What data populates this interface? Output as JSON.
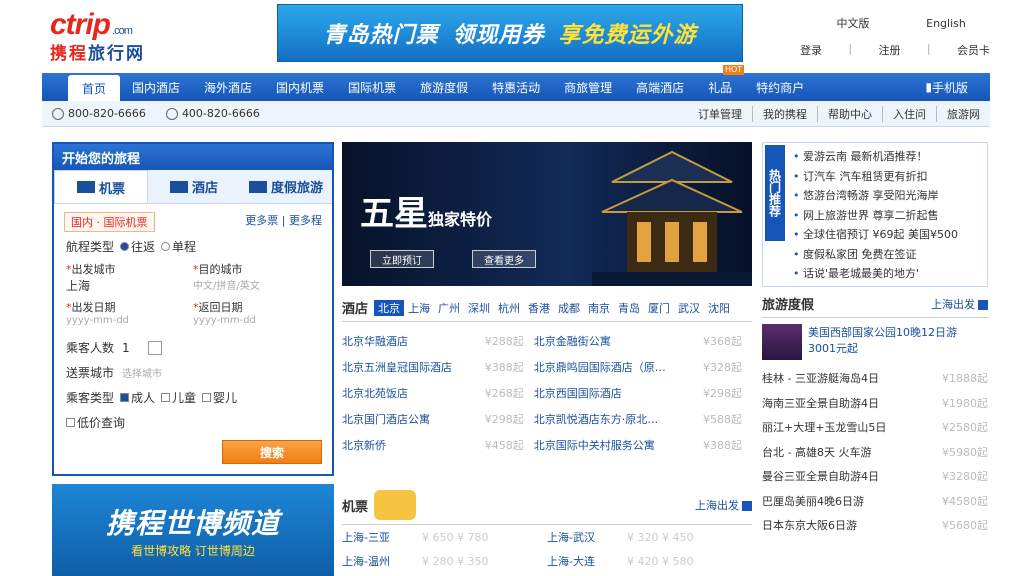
{
  "logo": {
    "brand": "ctrip",
    "domain": ".com",
    "cn_1": "携程",
    "cn_2": "旅行网"
  },
  "banner": {
    "part1": "青岛热门票",
    "part2": "领现用券",
    "part3": "享免费运外游"
  },
  "top": {
    "lang_cn": "中文版",
    "lang_en": "English",
    "login": "登录",
    "register": "注册",
    "card": "会员卡",
    "sep": "|"
  },
  "nav": {
    "items": [
      "首页",
      "国内酒店",
      "海外酒店",
      "国内机票",
      "国际机票",
      "旅游度假",
      "特惠活动",
      "商旅管理",
      "高端酒店",
      "礼品",
      "特约商户"
    ],
    "hot_badge": "HOT",
    "mobile": "手机版"
  },
  "subbar": {
    "phone1": "800-820-6666",
    "phone2": "400-820-6666",
    "links": [
      "订单管理",
      "我的携程",
      "帮助中心",
      "入住问",
      "旅游网"
    ]
  },
  "booking": {
    "header": "开始您的旅程",
    "tabs": [
      "机票",
      "酒店",
      "度假旅游"
    ],
    "flight_tab": "国内 · 国际机票",
    "flight_links": "更多票 | 更多程",
    "trip_type_label": "航程类型",
    "trip_options": [
      "往返",
      "单程"
    ],
    "from_label": "出发城市",
    "from_value": "上海",
    "to_label": "目的城市",
    "to_placeholder": "中文/拼音/英文",
    "depart_label": "出发日期",
    "depart_placeholder": "yyyy-mm-dd",
    "return_label": "返回日期",
    "return_placeholder": "yyyy-mm-dd",
    "passengers_label": "乘客人数",
    "passengers_value": "1",
    "delivery_label": "送票城市",
    "delivery_placeholder": "选择城市",
    "ptype_label": "乘客类型",
    "ptype_options": [
      "成人",
      "儿童",
      "婴儿"
    ],
    "query_link": "低价查询",
    "search_button": "搜索"
  },
  "expo": {
    "title": "携程世博频道",
    "subtitle": "看世博攻略 订世博周边"
  },
  "hero": {
    "title": "五星",
    "subtitle": "独家特价",
    "btn1": "立即预订",
    "btn2": "查看更多"
  },
  "hotels": {
    "title": "酒店",
    "cities": [
      "北京",
      "上海",
      "广州",
      "深圳",
      "杭州",
      "香港",
      "成都",
      "南京",
      "青岛",
      "厦门",
      "武汉",
      "沈阳"
    ],
    "rows": [
      [
        "北京华融酒店",
        "¥288起",
        "北京金融街公寓",
        "¥368起"
      ],
      [
        "北京五洲皇冠国际酒店",
        "¥388起",
        "北京鼎鸣园国际酒店（原…",
        "¥328起"
      ],
      [
        "北京北苑饭店",
        "¥268起",
        "北京西国国际酒店",
        "¥298起"
      ],
      [
        "北京国门酒店公寓",
        "¥298起",
        "北京凯悦酒店东方·原北…",
        "¥588起"
      ],
      [
        "北京新侨",
        "¥458起",
        "北京国际中关村服务公寓",
        "¥388起"
      ]
    ]
  },
  "flights": {
    "title": "机票",
    "departure": "上海出发",
    "rows": [
      [
        "上海-三亚",
        "¥ 650 ¥ 780",
        "上海-武汉",
        "¥ 320 ¥ 450"
      ],
      [
        "上海-温州",
        "¥ 280 ¥ 350",
        "上海-大连",
        "¥ 420 ¥ 580"
      ]
    ]
  },
  "hot_news": {
    "tag": "热门推荐",
    "items": [
      "爱游云南 最新机酒推荐！",
      "订汽车 汽车租赁更有折扣",
      "悠游台湾畅游 享受阳光海岸",
      "网上旅游世界 尊享二折起售",
      "全球住宿预订 ¥69起 美国¥500",
      "度假私家团 免费在签证",
      "话说'最老城最美的地方'"
    ]
  },
  "vacation": {
    "title": "旅游度假",
    "departure": "上海出发",
    "featured": "美国西部国家公园10晚12日游3001元起",
    "rows": [
      [
        "桂林 - 三亚游艇海岛4日",
        "¥1888起"
      ],
      [
        "海南三亚全景自助游4日",
        "¥1980起"
      ],
      [
        "丽江+大理+玉龙雪山5日",
        "¥2580起"
      ],
      [
        "台北 - 高雄8天 火车游",
        "¥5980起"
      ],
      [
        "曼谷三亚全景自助游4日",
        "¥3280起"
      ],
      [
        "巴厘岛美丽4晚6日游",
        "¥4580起"
      ],
      [
        "日本东京大阪6日游",
        "¥5680起"
      ]
    ]
  }
}
